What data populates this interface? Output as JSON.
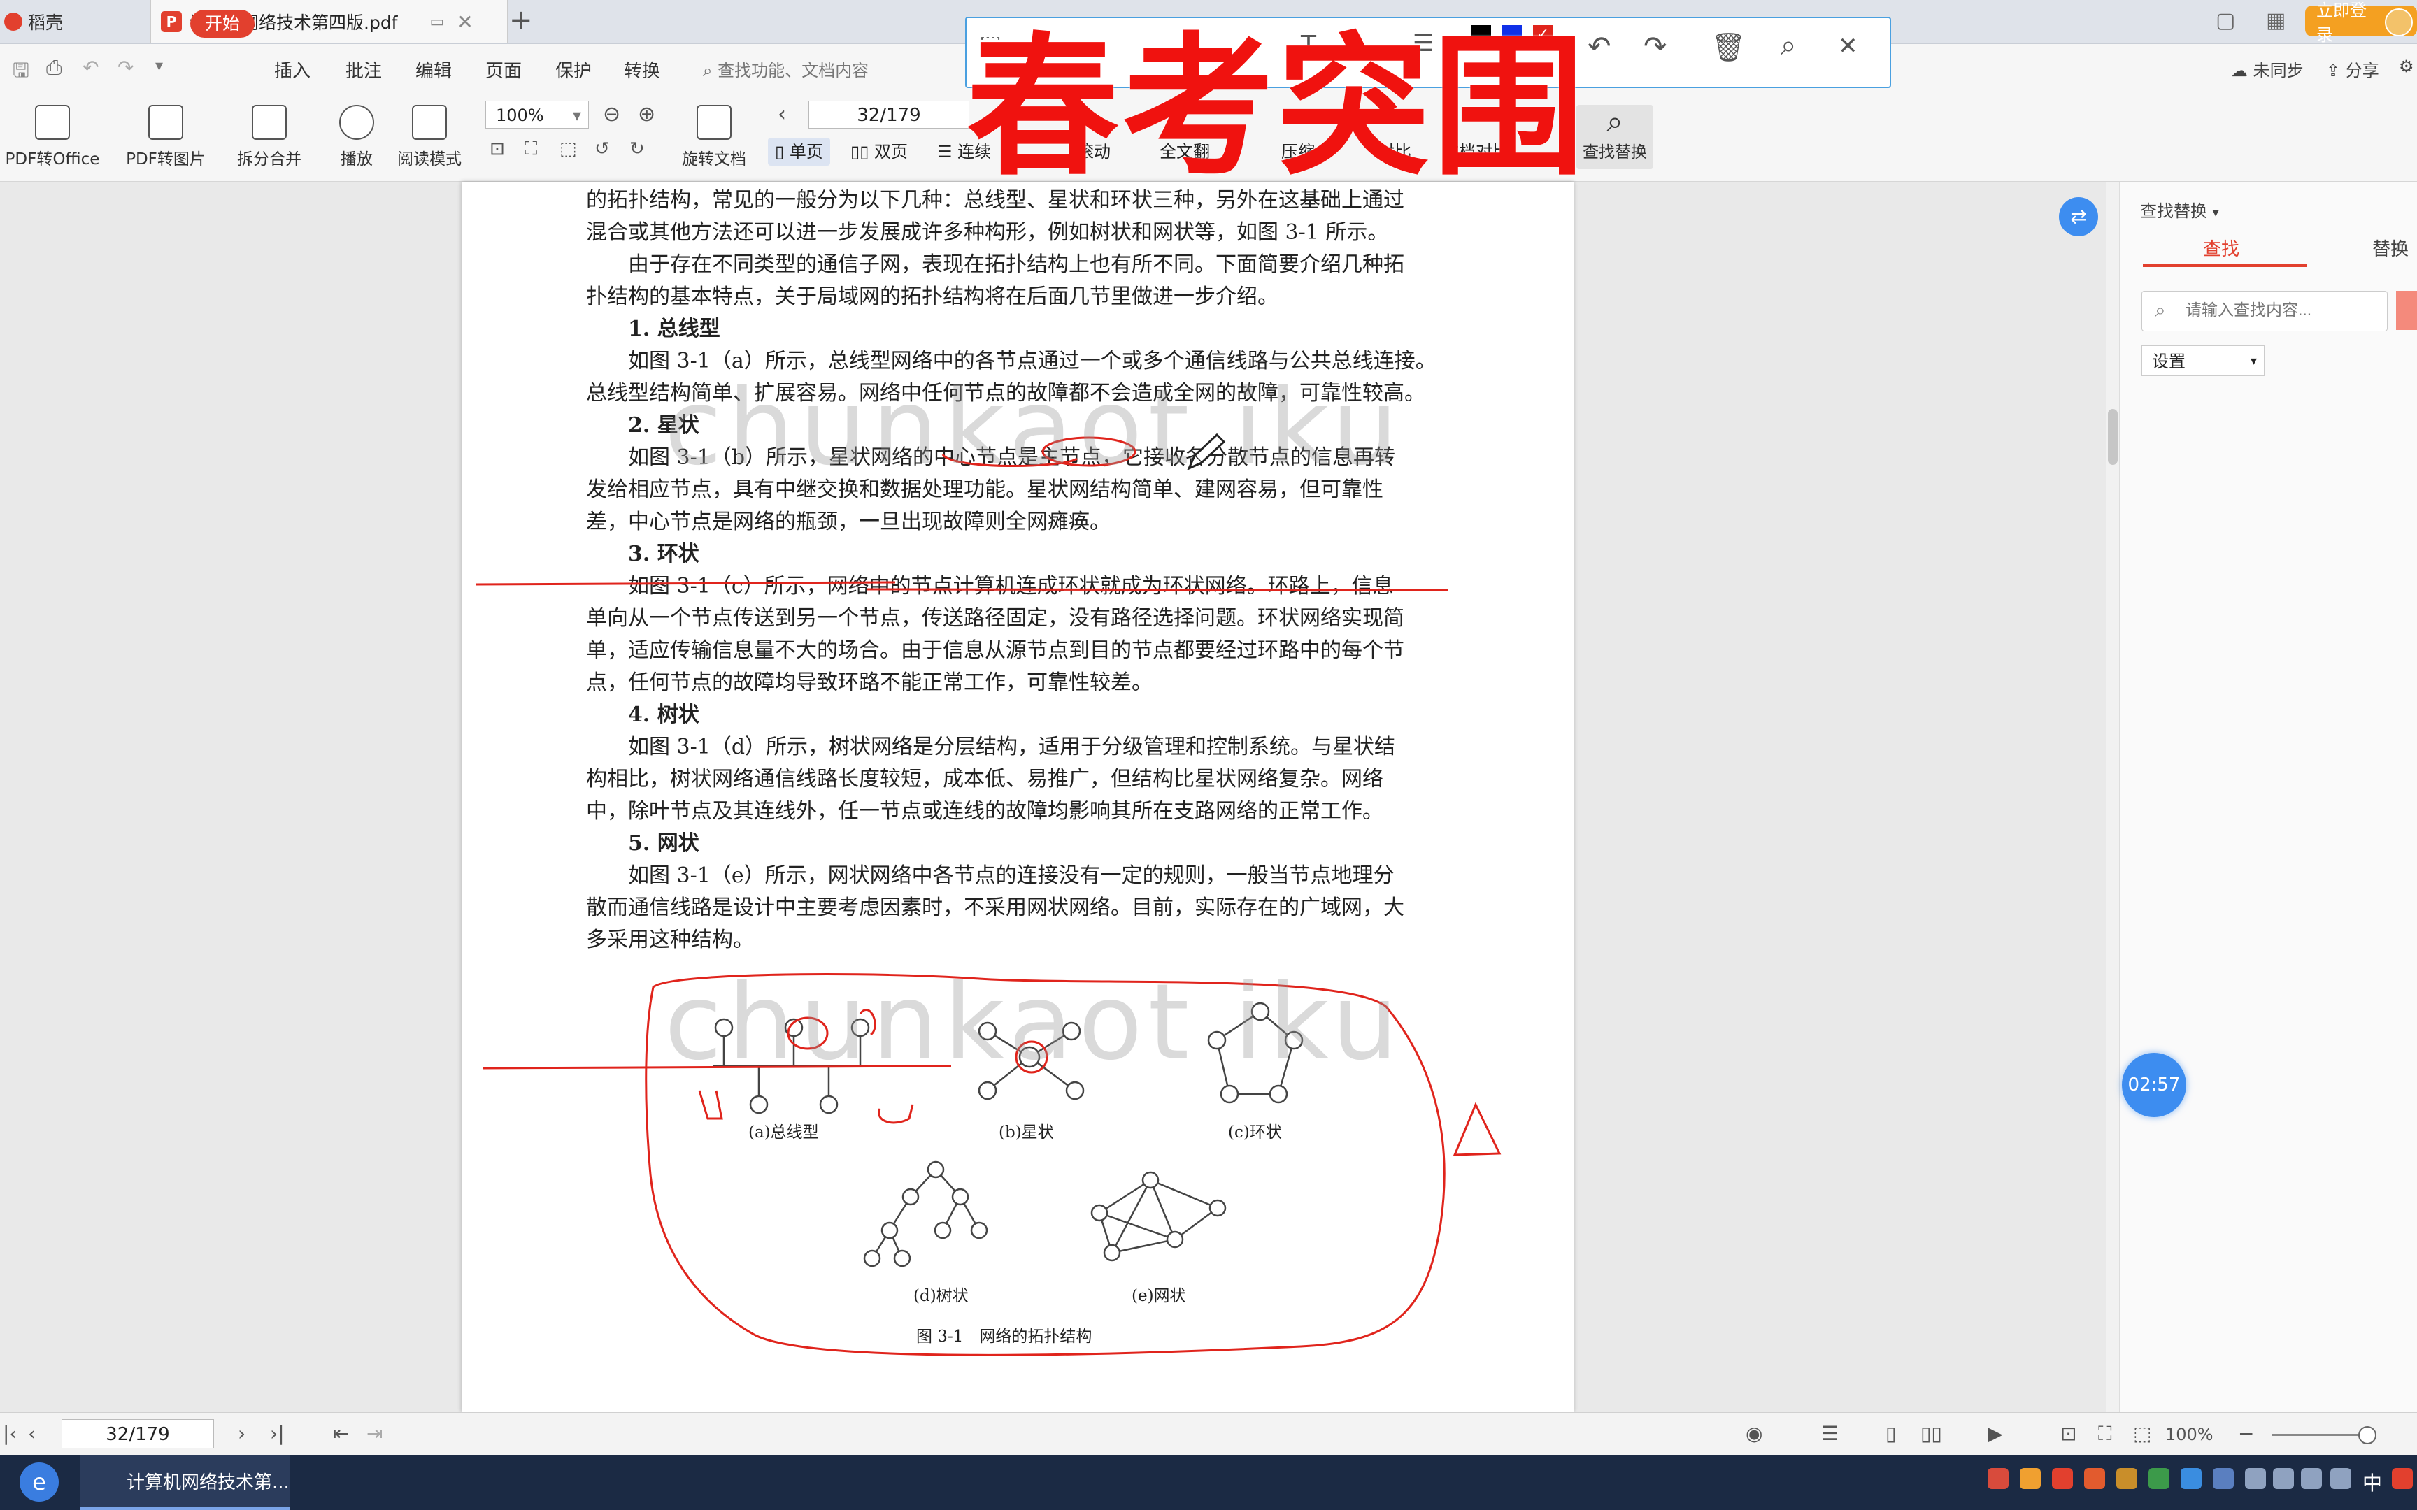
{
  "tabs": {
    "home": "稻壳",
    "doc": "计算机网络技术第四版.pdf"
  },
  "login_label": "立即登录",
  "menu": [
    "开始",
    "插入",
    "批注",
    "编辑",
    "页面",
    "保护",
    "转换"
  ],
  "search_hint": "查找功能、文档内容",
  "sync": {
    "unsync": "未同步",
    "share": "分享"
  },
  "ribbon": {
    "pdf_office": "PDF转Office",
    "pdf_image": "PDF转图片",
    "split_merge": "拆分合并",
    "play": "播放",
    "read_mode": "阅读模式",
    "zoom": "100%",
    "page": "32/179",
    "rotate": "旋转文档",
    "single": "单页",
    "double": "双页",
    "continuous": "连续",
    "scroll": "滚动",
    "fulltext": "全文翻",
    "compress": "压缩",
    "compare": "对比",
    "doc_compare": "文档对比",
    "find_replace": "查找替换"
  },
  "overlay_title": "春考突围",
  "watermark": "chunkaot iku",
  "document": {
    "lines": [
      {
        "text": "的拓扑结构，常见的一般分为以下几种：总线型、星状和环状三种，另外在这基础上通过",
        "head": false
      },
      {
        "text": "混合或其他方法还可以进一步发展成许多种构形，例如树状和网状等，如图 3-1 所示。",
        "head": false
      },
      {
        "text": "　　由于存在不同类型的通信子网，表现在拓扑结构上也有所不同。下面简要介绍几种拓",
        "head": false
      },
      {
        "text": "扑结构的基本特点，关于局域网的拓扑结构将在后面几节里做进一步介绍。",
        "head": false
      },
      {
        "text": "　　1. 总线型",
        "head": true
      },
      {
        "text": "　　如图 3-1（a）所示，总线型网络中的各节点通过一个或多个通信线路与公共总线连接。",
        "head": false
      },
      {
        "text": "总线型结构简单、扩展容易。网络中任何节点的故障都不会造成全网的故障，可靠性较高。",
        "head": false
      },
      {
        "text": "　　2. 星状",
        "head": true
      },
      {
        "text": "　　如图 3-1（b）所示，星状网络的中心节点是主节点，它接收各分散节点的信息再转",
        "head": false
      },
      {
        "text": "发给相应节点，具有中继交换和数据处理功能。星状网结构简单、建网容易，但可靠性",
        "head": false
      },
      {
        "text": "差，中心节点是网络的瓶颈，一旦出现故障则全网瘫痪。",
        "head": false
      },
      {
        "text": "　　3. 环状",
        "head": true
      },
      {
        "text": "　　如图 3-1（c）所示，网络中的节点计算机连成环状就成为环状网络。环路上，信息",
        "head": false
      },
      {
        "text": "单向从一个节点传送到另一个节点，传送路径固定，没有路径选择问题。环状网络实现简",
        "head": false
      },
      {
        "text": "单，适应传输信息量不大的场合。由于信息从源节点到目的节点都要经过环路中的每个节",
        "head": false
      },
      {
        "text": "点，任何节点的故障均导致环路不能正常工作，可靠性较差。",
        "head": false
      },
      {
        "text": "　　4. 树状",
        "head": true
      },
      {
        "text": "　　如图 3-1（d）所示，树状网络是分层结构，适用于分级管理和控制系统。与星状结",
        "head": false
      },
      {
        "text": "构相比，树状网络通信线路长度较短，成本低、易推广，但结构比星状网络复杂。网络",
        "head": false
      },
      {
        "text": "中，除叶节点及其连线外，任一节点或连线的故障均影响其所在支路网络的正常工作。",
        "head": false
      },
      {
        "text": "　　5. 网状",
        "head": true
      },
      {
        "text": "　　如图 3-1（e）所示，网状网络中各节点的连接没有一定的规则，一般当节点地理分",
        "head": false
      },
      {
        "text": "散而通信线路是设计中主要考虑因素时，不采用网状网络。目前，实际存在的广域网，大",
        "head": false
      },
      {
        "text": "多采用这种结构。",
        "head": false
      }
    ],
    "captions": {
      "a": "(a)总线型",
      "b": "(b)星状",
      "c": "(c)环状",
      "d": "(d)树状",
      "e": "(e)网状",
      "figure": "图 3-1　网络的拓扑结构"
    }
  },
  "right_panel": {
    "title": "查找替换",
    "tab_find": "查找",
    "tab_replace": "替换",
    "placeholder": "请输入查找内容...",
    "settings": "设置"
  },
  "timer": "02:57",
  "status": {
    "page": "32/179",
    "zoom": "100%"
  },
  "taskbar": {
    "app": "计算机网络技术第...",
    "lang": "中"
  },
  "colors": {
    "accent": "#e2402e",
    "overlay": "#f0120f",
    "annotation": "#e0241c",
    "timer": "#3d8df0"
  }
}
